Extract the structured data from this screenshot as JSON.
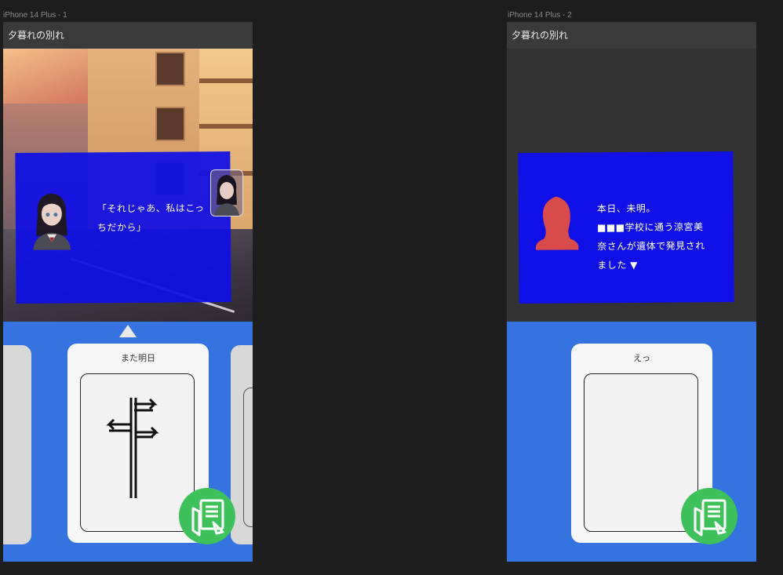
{
  "frames": [
    {
      "label": "iPhone 14 Plus - 1",
      "title": "夕暮れの別れ",
      "dialog_text_lines": [
        "「それじゃあ、私はこっ",
        "ちだから」"
      ],
      "card_title": "また明日"
    },
    {
      "label": "iPhone 14 Plus - 2",
      "title": "夕暮れの別れ",
      "dialog_text_lines": [
        "本日、未明。",
        "■■■学校に通う涼宮美",
        "奈さんが遺体で発見され",
        "ました ▼"
      ],
      "card_title": "えっ"
    }
  ],
  "icons": {
    "signpost": "signpost-icon",
    "write": "write-note-icon",
    "silhouette": "silhouette-icon",
    "up_arrow": "up-arrow-icon"
  },
  "colors": {
    "dialog_bg": "#0f0fe6",
    "hand_bg": "#3473e0",
    "fab_bg": "#3ec15a",
    "silhouette": "#d94a4a"
  }
}
